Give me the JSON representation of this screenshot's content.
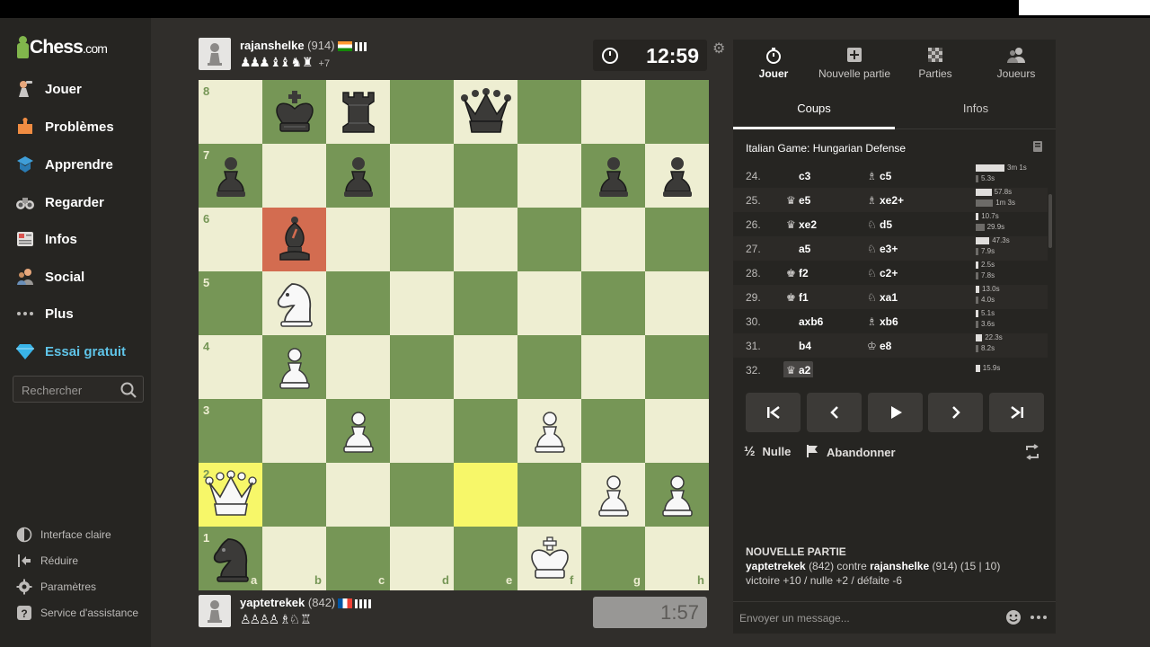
{
  "brand": {
    "name": "Chess",
    "suffix": ".com"
  },
  "sidebar": {
    "items": [
      {
        "label": "Jouer",
        "icon": "play-pawn-icon"
      },
      {
        "label": "Problèmes",
        "icon": "puzzle-icon"
      },
      {
        "label": "Apprendre",
        "icon": "learn-cap-icon"
      },
      {
        "label": "Regarder",
        "icon": "binoculars-icon"
      },
      {
        "label": "Infos",
        "icon": "news-icon"
      },
      {
        "label": "Social",
        "icon": "social-icon"
      },
      {
        "label": "Plus",
        "icon": "more-dots-icon"
      },
      {
        "label": "Essai gratuit",
        "icon": "diamond-icon"
      }
    ],
    "search_placeholder": "Rechercher",
    "bottom": [
      {
        "label": "Interface claire",
        "icon": "contrast-icon"
      },
      {
        "label": "Réduire",
        "icon": "collapse-icon"
      },
      {
        "label": "Paramètres",
        "icon": "settings-icon"
      },
      {
        "label": "Service d'assistance",
        "icon": "help-icon"
      }
    ]
  },
  "top_player": {
    "name": "rajanshelke",
    "rating": "(914)",
    "captured": "♟♟♟ ♝♝ ♞ ♜",
    "advantage": "+7",
    "clock": "12:59"
  },
  "bottom_player": {
    "name": "yaptetrekek",
    "rating": "(842)",
    "captured": "♙♙♙♙ ♗♘ ♖",
    "clock": "1:57"
  },
  "board": {
    "ranks": [
      "8",
      "7",
      "6",
      "5",
      "4",
      "3",
      "2",
      "1"
    ],
    "files": [
      "a",
      "b",
      "c",
      "d",
      "e",
      "f",
      "g",
      "h"
    ]
  },
  "panel": {
    "tabs": [
      {
        "label": "Jouer",
        "icon": "clock-icon"
      },
      {
        "label": "Nouvelle partie",
        "icon": "plus-square-icon"
      },
      {
        "label": "Parties",
        "icon": "checkerboard-icon"
      },
      {
        "label": "Joueurs",
        "icon": "players-icon"
      }
    ],
    "subtabs": [
      "Coups",
      "Infos"
    ],
    "opening": "Italian Game: Hungarian Defense",
    "moves": [
      {
        "num": "24.",
        "w": "c3",
        "wg": "",
        "b": "c5",
        "bg": "♗",
        "tw": "3m 1s",
        "tb": "5.3s",
        "fw": 0.4,
        "fb": 0.02
      },
      {
        "num": "25.",
        "w": "e5",
        "wg": "♛",
        "b": "xe2+",
        "bg": "♗",
        "tw": "57.8s",
        "tb": "1m 3s",
        "fw": 0.22,
        "fb": 0.24
      },
      {
        "num": "26.",
        "w": "xe2",
        "wg": "♛",
        "b": "d5",
        "bg": "♘",
        "tw": "10.7s",
        "tb": "29.9s",
        "fw": 0.04,
        "fb": 0.12
      },
      {
        "num": "27.",
        "w": "a5",
        "wg": "",
        "b": "e3+",
        "bg": "♘",
        "tw": "47.3s",
        "tb": "7.9s",
        "fw": 0.19,
        "fb": 0.03
      },
      {
        "num": "28.",
        "w": "f2",
        "wg": "♚",
        "b": "c2+",
        "bg": "♘",
        "tw": "2.5s",
        "tb": "7.8s",
        "fw": 0.01,
        "fb": 0.03
      },
      {
        "num": "29.",
        "w": "f1",
        "wg": "♚",
        "b": "xa1",
        "bg": "♘",
        "tw": "13.0s",
        "tb": "4.0s",
        "fw": 0.05,
        "fb": 0.02
      },
      {
        "num": "30.",
        "w": "axb6",
        "wg": "",
        "b": "xb6",
        "bg": "♗",
        "tw": "5.1s",
        "tb": "3.6s",
        "fw": 0.02,
        "fb": 0.01
      },
      {
        "num": "31.",
        "w": "b4",
        "wg": "",
        "b": "e8",
        "bg": "♔",
        "tw": "22.3s",
        "tb": "8.2s",
        "fw": 0.09,
        "fb": 0.03
      },
      {
        "num": "32.",
        "w": "a2",
        "wg": "♛",
        "b": "",
        "bg": "",
        "tw": "15.9s",
        "tb": "",
        "fw": 0.06,
        "fb": 0
      }
    ],
    "draw_label": "Nulle",
    "draw_icon": "½",
    "resign_label": "Abandonner",
    "new_game_title": "NOUVELLE PARTIE",
    "game_line_white": "yaptetrekek",
    "game_line_white_rating": "(842) contre",
    "game_line_black": "rajanshelke",
    "game_line_black_rating": "(914) (15 | 10)",
    "results": "victoire +10 / nulle +2 / défaite -6",
    "message_placeholder": "Envoyer un message..."
  },
  "colors": {
    "light_square": "#eeeed2",
    "dark_square": "#769656",
    "highlight_last_from": "#d36c50",
    "highlight_last_to": "#f7f769",
    "accent": "#81b64c"
  }
}
